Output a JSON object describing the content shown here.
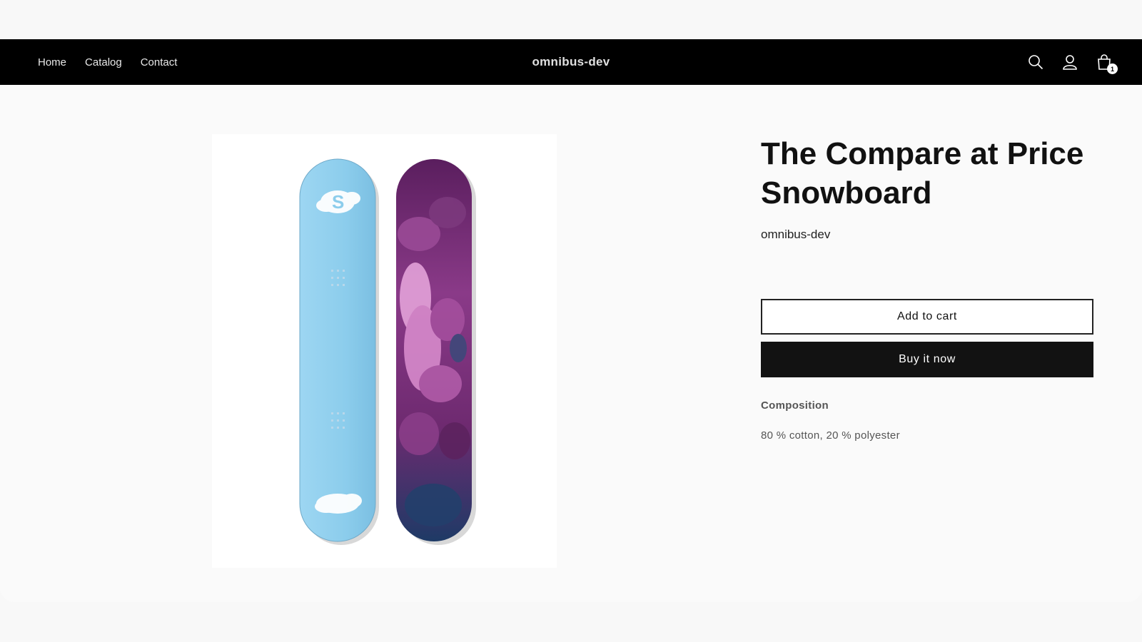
{
  "store": {
    "name": "omnibus-dev"
  },
  "nav": {
    "items": [
      "Home",
      "Catalog",
      "Contact"
    ]
  },
  "header_icons": [
    "search-icon",
    "account-icon",
    "cart-icon"
  ],
  "cart": {
    "count": "1"
  },
  "product": {
    "title": "The Compare at Price Snowboard",
    "vendor": "omnibus-dev",
    "add_to_cart_label": "Add to cart",
    "buy_now_label": "Buy it now",
    "composition_heading": "Composition",
    "composition_text": "80 % cotton, 20 % polyester"
  },
  "colors": {
    "header_bg": "#000000",
    "board_left": "#8ecdec",
    "board_right": "#7a2e78"
  }
}
